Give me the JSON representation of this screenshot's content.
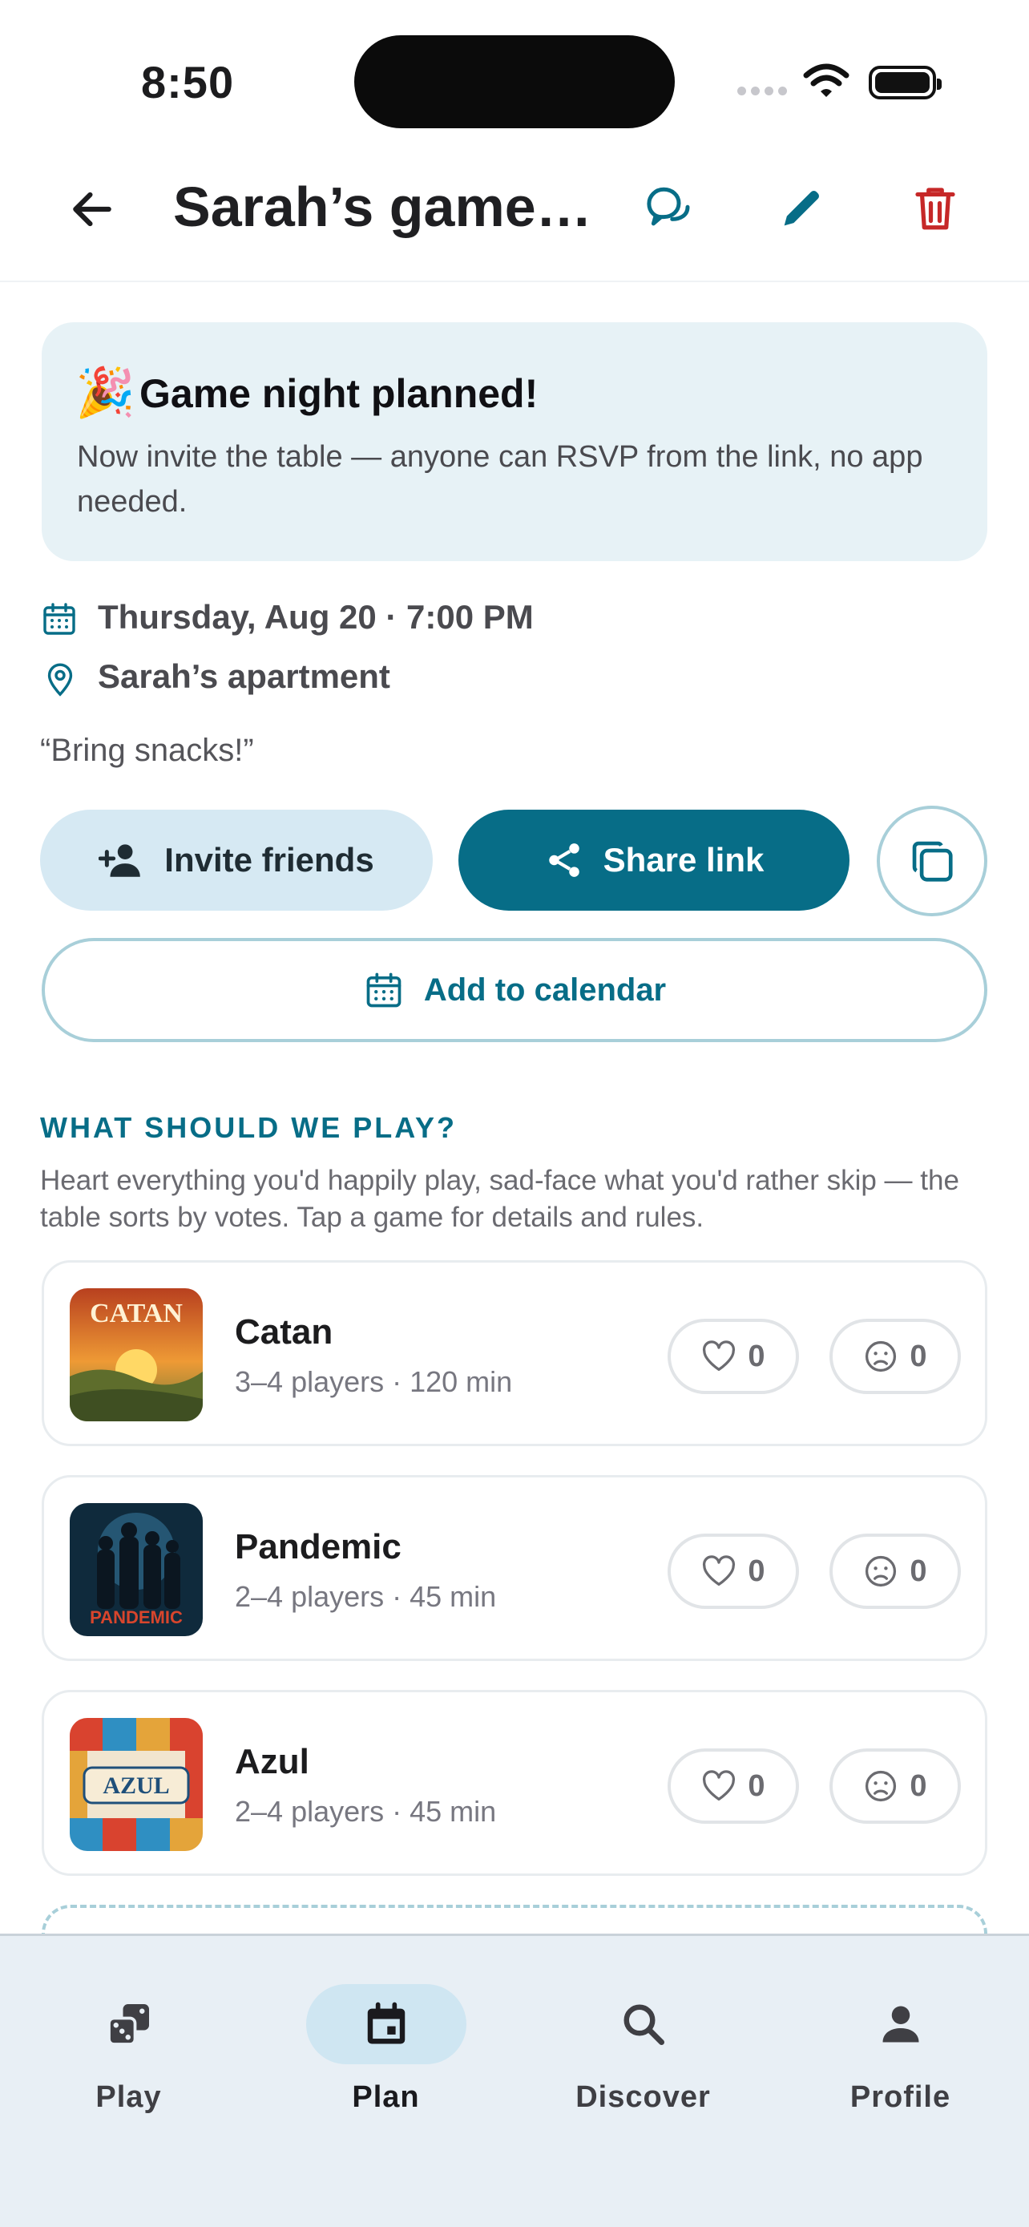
{
  "status": {
    "time": "8:50"
  },
  "header": {
    "title": "Sarah’s game…"
  },
  "banner": {
    "emoji": "🎉",
    "title": "Game night planned!",
    "body": "Now invite the table — anyone can RSVP from the link, no app needed."
  },
  "event": {
    "datetime": "Thursday, Aug 20 · 7:00 PM",
    "location": "Sarah’s apartment",
    "note": "“Bring snacks!”"
  },
  "actions": {
    "invite_label": "Invite friends",
    "share_label": "Share link",
    "calendar_label": "Add to calendar"
  },
  "games_section": {
    "heading": "WHAT SHOULD WE PLAY?",
    "subtitle": "Heart everything you'd happily play, sad-face what you'd rather skip — the table sorts by votes. Tap a game for details and rules.",
    "games": [
      {
        "name": "Catan",
        "meta": "3–4 players · 120 min",
        "likes": "0",
        "skips": "0",
        "thumb_label": "CATAN"
      },
      {
        "name": "Pandemic",
        "meta": "2–4 players · 45 min",
        "likes": "0",
        "skips": "0",
        "thumb_label": "PANDEMIC"
      },
      {
        "name": "Azul",
        "meta": "2–4 players · 45 min",
        "likes": "0",
        "skips": "0",
        "thumb_label": "AZUL"
      }
    ]
  },
  "tabs": [
    {
      "label": "Play",
      "icon": "dice-icon",
      "active": false
    },
    {
      "label": "Plan",
      "icon": "calendar-icon",
      "active": true
    },
    {
      "label": "Discover",
      "icon": "search-icon",
      "active": false
    },
    {
      "label": "Profile",
      "icon": "person-icon",
      "active": false
    }
  ],
  "colors": {
    "accent": "#076d87",
    "banner_bg": "#e7f2f6",
    "delete": "#c62828",
    "tabbar_bg": "#e8eff5"
  }
}
